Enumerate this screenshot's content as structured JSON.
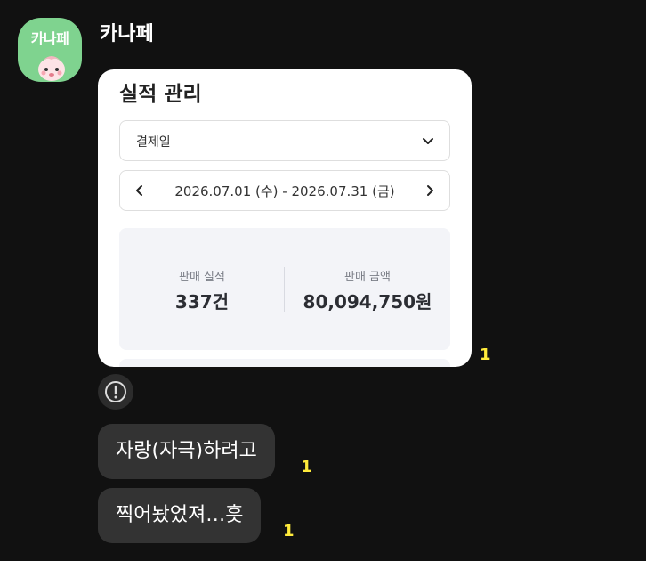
{
  "sender": {
    "avatar_text": "카나페",
    "name": "카나페"
  },
  "card": {
    "title": "실적 관리",
    "filter_label": "결제일",
    "date_range": "2026.07.01 (수) - 2026.07.31 (금)",
    "stats": [
      {
        "label": "판매 실적",
        "value": "337건"
      },
      {
        "label": "판매 금액",
        "value": "80,094,750원"
      }
    ],
    "read_count": "1"
  },
  "messages": [
    {
      "text": "자랑(자극)하려고",
      "read_count": "1"
    },
    {
      "text": "찍어놨었져…흣",
      "read_count": "1"
    }
  ],
  "colors": {
    "background": "#111111",
    "bubble": "#333333",
    "unread_count": "#ffeb3b",
    "avatar_bg": "#7fd38f"
  },
  "icons": {
    "card_filter": "chevron-down-icon",
    "date_prev": "chevron-left-icon",
    "date_next": "chevron-right-icon",
    "warning": "exclamation-circle-icon"
  }
}
